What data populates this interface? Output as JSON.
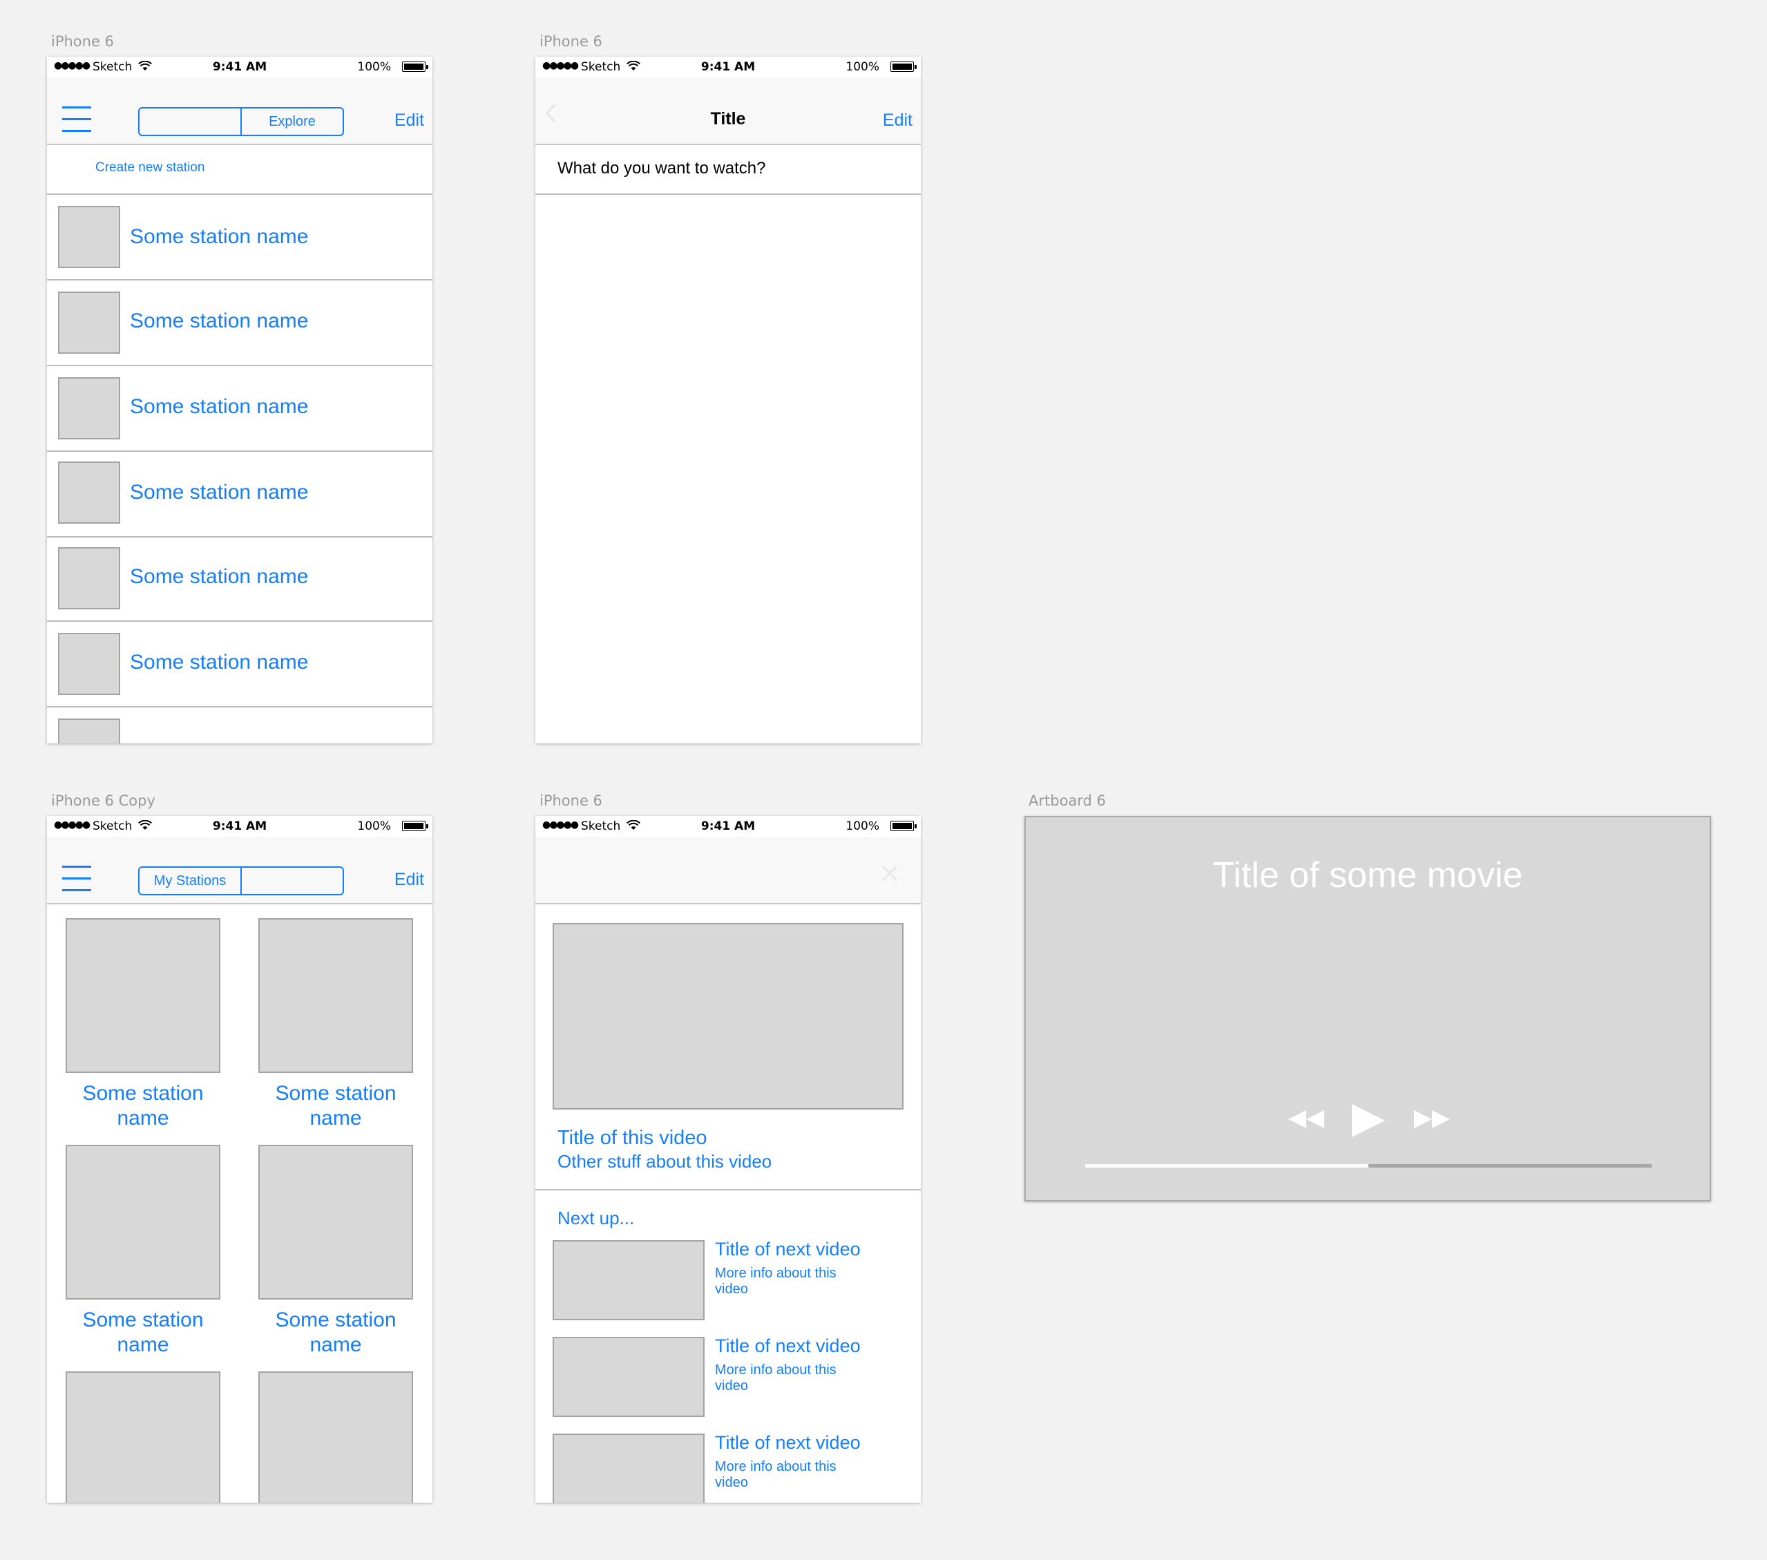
{
  "status": {
    "signal": "●●●●●",
    "carrier": "Sketch",
    "time": "9:41 AM",
    "battery": "100%"
  },
  "artboards": {
    "a1": "iPhone 6",
    "a2": "iPhone 6",
    "a3": "iPhone 6 Copy",
    "a4": "iPhone 6",
    "a5": "Artboard 6"
  },
  "screen1": {
    "segment": [
      "",
      "Explore"
    ],
    "edit": "Edit",
    "create": "Create new station",
    "stations": [
      "Some station name",
      "Some station name",
      "Some station name",
      "Some station name",
      "Some station name",
      "Some station name"
    ]
  },
  "screen2": {
    "title": "Title",
    "edit": "Edit",
    "prompt": "What do you want to watch?"
  },
  "screen3": {
    "segment": [
      "My Stations",
      ""
    ],
    "edit": "Edit",
    "grid": [
      "Some station name",
      "Some station name",
      "Some station name",
      "Some station name"
    ]
  },
  "screen4": {
    "video_title": "Title of this video",
    "video_sub": "Other stuff about this video",
    "next_label": "Next up...",
    "next": [
      {
        "title": "Title of next video",
        "info": "More info about this video"
      },
      {
        "title": "Title of next video",
        "info": "More info about this video"
      },
      {
        "title": "Title of next video",
        "info": "More info about this video"
      }
    ]
  },
  "screen5": {
    "movie_title": "Title of some movie",
    "progress": 0.5
  }
}
